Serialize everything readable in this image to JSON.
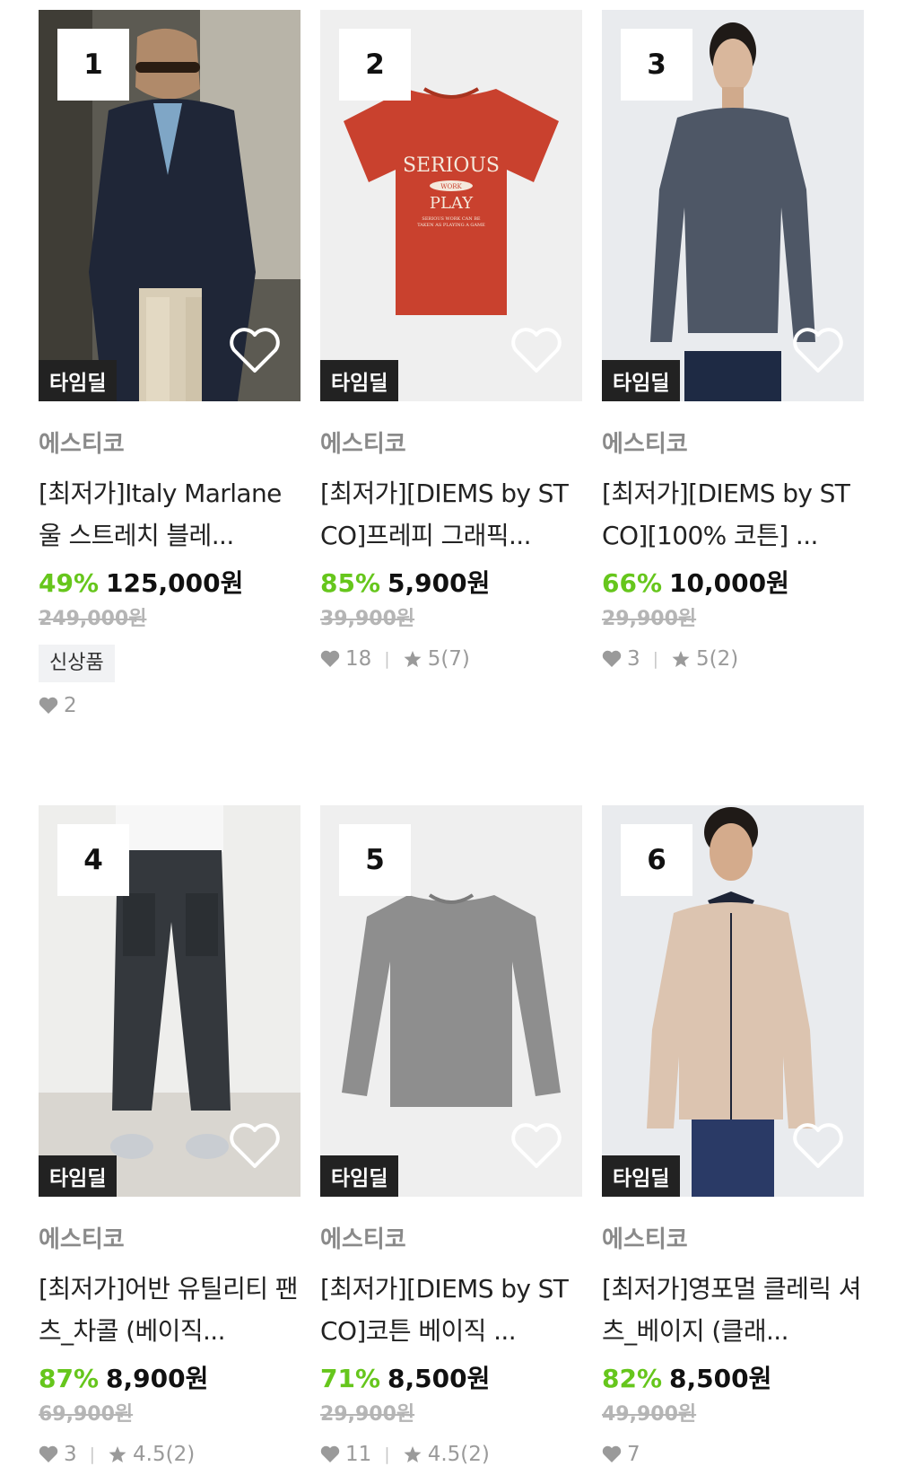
{
  "products": [
    {
      "rank": "1",
      "brand": "에스티코",
      "title": "[최저가]Italy Marlane 울 스트레치 블레...",
      "discount": "49%",
      "price": "125,000원",
      "original_price": "249,000원",
      "deal_badge": "타임딜",
      "new_badge": "신상품",
      "likes": "2",
      "rating": "",
      "image_icon": "navy-blazer-photo"
    },
    {
      "rank": "2",
      "brand": "에스티코",
      "title": "[최저가][DIEMS by STCO]프레피 그래픽...",
      "discount": "85%",
      "price": "5,900원",
      "original_price": "39,900원",
      "deal_badge": "타임딜",
      "likes": "18",
      "rating": "5(7)",
      "image_icon": "red-graphic-tshirt-photo",
      "tee_text": {
        "line1": "SERIOUS",
        "line2": "WORK",
        "line3": "PLAY",
        "line4": "SERIOUS WORK CAN BE",
        "line5": "TAKEN AS PLAYING A GAME"
      }
    },
    {
      "rank": "3",
      "brand": "에스티코",
      "title": "[최저가][DIEMS by STCO][100% 코튼] ...",
      "discount": "66%",
      "price": "10,000원",
      "original_price": "29,900원",
      "deal_badge": "타임딜",
      "likes": "3",
      "rating": "5(2)",
      "image_icon": "gray-longsleeve-model-photo"
    },
    {
      "rank": "4",
      "brand": "에스티코",
      "title": "[최저가]어반 유틸리티 팬츠_차콜 (베이직...",
      "discount": "87%",
      "price": "8,900원",
      "original_price": "69,900원",
      "deal_badge": "타임딜",
      "likes": "3",
      "rating": "4.5(2)",
      "image_icon": "charcoal-pants-photo"
    },
    {
      "rank": "5",
      "brand": "에스티코",
      "title": "[최저가][DIEMS by STCO]코튼 베이직 ...",
      "discount": "71%",
      "price": "8,500원",
      "original_price": "29,900원",
      "deal_badge": "타임딜",
      "likes": "11",
      "rating": "4.5(2)",
      "image_icon": "gray-tshirt-flat-photo"
    },
    {
      "rank": "6",
      "brand": "에스티코",
      "title": "[최저가]영포멀 클레릭 셔츠_베이지 (클래...",
      "discount": "82%",
      "price": "8,500원",
      "original_price": "49,900원",
      "deal_badge": "타임딜",
      "likes": "7",
      "rating": "",
      "image_icon": "beige-shirt-model-photo"
    }
  ],
  "colors": {
    "discount": "#66c61c",
    "deal_bg": "#222222",
    "brand": "#8a8a8a"
  }
}
